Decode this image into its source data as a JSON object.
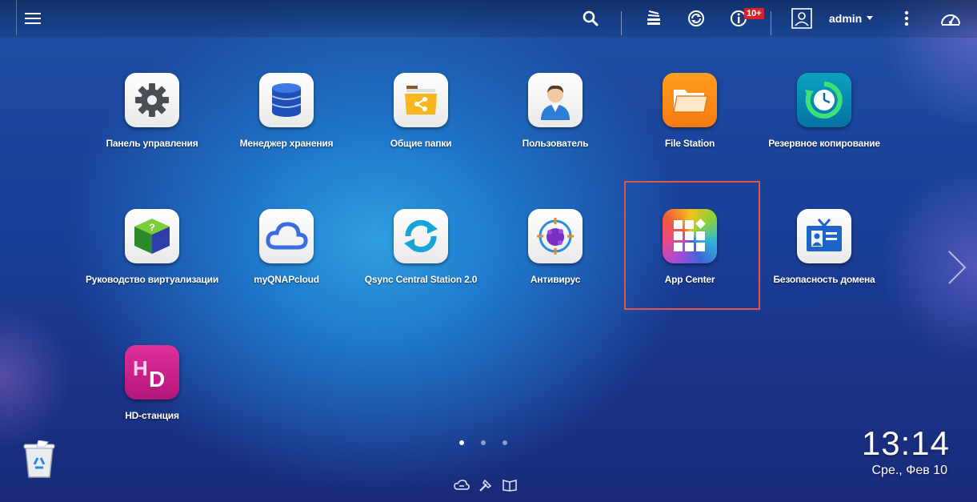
{
  "topbar": {
    "user": "admin",
    "notification_badge": "10+",
    "icons": [
      "menu-icon",
      "search-icon",
      "task-stack-icon",
      "sync-icon",
      "info-icon",
      "user-icon",
      "more-icon",
      "dashboard-icon"
    ]
  },
  "apps": [
    {
      "label": "Панель управления",
      "icon": "gear-icon"
    },
    {
      "label": "Менеджер хранения",
      "icon": "database-icon"
    },
    {
      "label": "Общие папки",
      "icon": "shared-folder-icon"
    },
    {
      "label": "Пользователь",
      "icon": "user-avatar-icon"
    },
    {
      "label": "File Station",
      "icon": "folder-icon"
    },
    {
      "label": "Резервное копирование",
      "icon": "backup-clock-icon"
    },
    {
      "label": "Руководство виртуализации",
      "icon": "cube-icon"
    },
    {
      "label": "myQNAPcloud",
      "icon": "cloud-icon"
    },
    {
      "label": "Qsync Central Station 2.0",
      "icon": "sync-arrows-icon"
    },
    {
      "label": "Антивирус",
      "icon": "virus-target-icon"
    },
    {
      "label": "App Center",
      "icon": "app-grid-icon"
    },
    {
      "label": "Безопасность домена",
      "icon": "id-badge-icon"
    },
    {
      "label": "HD-станция",
      "icon": "hd-icon"
    }
  ],
  "colors": {
    "highlight": "#e0554e",
    "badge": "#d8232a"
  },
  "pagination": {
    "pages": 3,
    "current": 1
  },
  "clock": {
    "time": "13:14",
    "date": "Сре., Фев 10"
  }
}
